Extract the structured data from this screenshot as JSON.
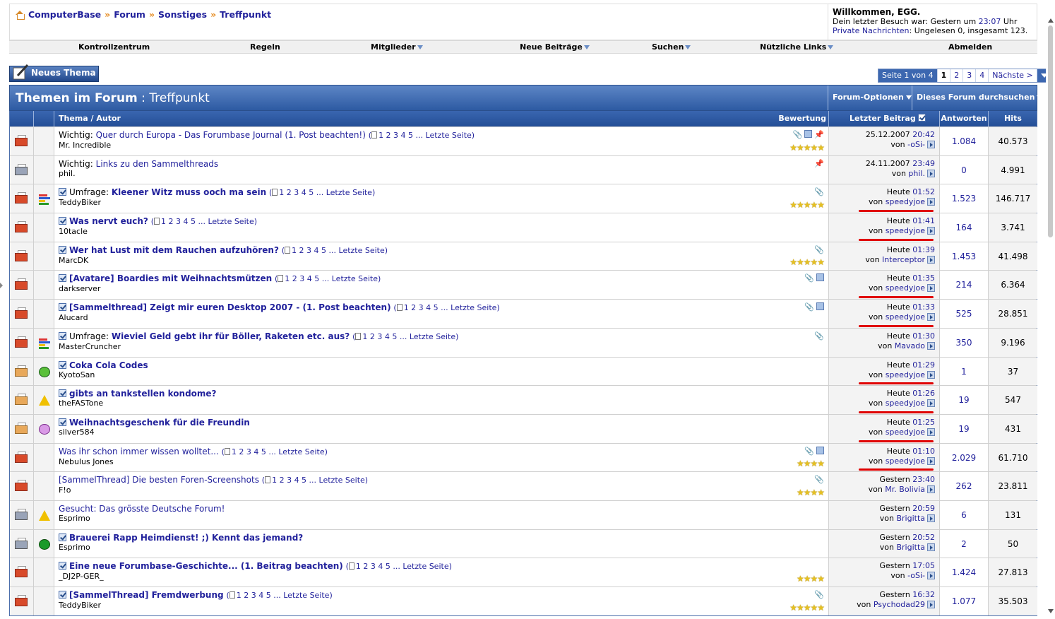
{
  "breadcrumb": [
    "ComputerBase",
    "Forum",
    "Sonstiges",
    "Treffpunkt"
  ],
  "breadcrumb_sep": "»",
  "welcome": {
    "title": "Willkommen, EGG.",
    "last_visit_prefix": "Dein letzter Besuch war: Gestern um",
    "last_visit_time": "23:07",
    "last_visit_suffix": "Uhr",
    "pm_label": "Private Nachrichten",
    "pm_status": ": Ungelesen 0, insgesamt 123."
  },
  "navbar": [
    "Kontrollzentrum",
    "Regeln",
    "Mitglieder",
    "Neue Beiträge",
    "Suchen",
    "Nützliche Links",
    "Abmelden"
  ],
  "new_thread_label": "Neues Thema",
  "pagination": {
    "info": "Seite 1 von 4",
    "pages": [
      "1",
      "2",
      "3",
      "4"
    ],
    "current": "1",
    "next": "Nächste >"
  },
  "forum": {
    "title_prefix": "Themen im Forum",
    "title_sep": " : ",
    "forum_name": "Treffpunkt",
    "options": "Forum-Optionen",
    "search": "Dieses Forum durchsuchen"
  },
  "columns": {
    "thread": "Thema / Autor",
    "rating": "Bewertung",
    "last_post": "Letzter Beitrag",
    "replies": "Antworten",
    "hits": "Hits"
  },
  "last_post_by": "von",
  "threads": [
    {
      "prefix": "Wichtig: ",
      "title": "Quer durch Europa - Das Forumbase Journal (1. Post beachten!)",
      "pages": "1 2 3 4 5 ... Letzte Seite",
      "author": "Mr. Incredible",
      "date": "25.12.2007",
      "time": "20:42",
      "user": "-oSi-",
      "replies": "1.084",
      "hits": "40.573",
      "bold": false,
      "check": false,
      "status": "new",
      "ticon": "",
      "stars": 5,
      "flags": [
        "clip",
        "chk",
        "pin"
      ],
      "red": false
    },
    {
      "prefix": "Wichtig: ",
      "title": "Links zu den Sammelthreads",
      "pages": "",
      "author": "phil.",
      "date": "24.11.2007",
      "time": "23:49",
      "user": "phil.",
      "replies": "0",
      "hits": "4.991",
      "bold": false,
      "check": false,
      "status": "lock",
      "ticon": "",
      "stars": 0,
      "flags": [
        "pin"
      ],
      "red": false
    },
    {
      "prefix": "Umfrage: ",
      "title": "Kleener Witz muss ooch ma sein",
      "pages": "1 2 3 4 5 ... Letzte Seite",
      "author": "TeddyBiker",
      "date": "Heute",
      "time": "01:52",
      "user": "speedyjoe",
      "replies": "1.523",
      "hits": "146.717",
      "bold": true,
      "check": true,
      "status": "new",
      "ticon": "poll",
      "stars": 5,
      "flags": [
        "clip"
      ],
      "red": true
    },
    {
      "prefix": "",
      "title": "Was nervt euch?",
      "pages": "1 2 3 4 5 ... Letzte Seite",
      "author": "10tacle",
      "date": "Heute",
      "time": "01:41",
      "user": "speedyjoe",
      "replies": "164",
      "hits": "3.741",
      "bold": true,
      "check": true,
      "status": "new",
      "ticon": "",
      "stars": 0,
      "flags": [],
      "red": true
    },
    {
      "prefix": "",
      "title": "Wer hat Lust mit dem Rauchen aufzuhören?",
      "pages": "1 2 3 4 5 ... Letzte Seite",
      "author": "MarcDK",
      "date": "Heute",
      "time": "01:39",
      "user": "Interceptor",
      "replies": "1.453",
      "hits": "41.498",
      "bold": true,
      "check": true,
      "status": "new",
      "ticon": "",
      "stars": 5,
      "flags": [
        "clip"
      ],
      "red": false
    },
    {
      "prefix": "",
      "title": "[Avatare] Boardies mit Weihnachtsmützen",
      "pages": "1 2 3 4 5 ... Letzte Seite",
      "author": "darkserver",
      "date": "Heute",
      "time": "01:35",
      "user": "speedyjoe",
      "replies": "214",
      "hits": "6.364",
      "bold": true,
      "check": true,
      "status": "new",
      "ticon": "",
      "stars": 0,
      "flags": [
        "clip",
        "chk"
      ],
      "red": true
    },
    {
      "prefix": "",
      "title": "[Sammelthread] Zeigt mir euren Desktop 2007 - (1. Post beachten)",
      "pages": "1 2 3 4 5 ... Letzte Seite",
      "author": "Alucard",
      "date": "Heute",
      "time": "01:33",
      "user": "speedyjoe",
      "replies": "525",
      "hits": "28.851",
      "bold": true,
      "check": true,
      "status": "new",
      "ticon": "",
      "stars": 0,
      "flags": [
        "clip",
        "chk"
      ],
      "red": true
    },
    {
      "prefix": "Umfrage: ",
      "title": "Wieviel Geld gebt ihr für Böller, Raketen etc. aus?",
      "pages": "1 2 3 4 5 ... Letzte Seite",
      "author": "MasterCruncher",
      "date": "Heute",
      "time": "01:30",
      "user": "Mavado",
      "replies": "350",
      "hits": "9.196",
      "bold": true,
      "check": true,
      "status": "new",
      "ticon": "poll",
      "stars": 0,
      "flags": [
        "clip"
      ],
      "red": false
    },
    {
      "prefix": "",
      "title": "Coka Cola Codes",
      "pages": "",
      "author": "KyotoSan",
      "date": "Heute",
      "time": "01:29",
      "user": "speedyjoe",
      "replies": "1",
      "hits": "37",
      "bold": true,
      "check": true,
      "status": "old",
      "ticon": "greensmile",
      "stars": 0,
      "flags": [],
      "red": true
    },
    {
      "prefix": "",
      "title": "gibts an tankstellen kondome?",
      "pages": "",
      "author": "theFASTone",
      "date": "Heute",
      "time": "01:26",
      "user": "speedyjoe",
      "replies": "19",
      "hits": "547",
      "bold": true,
      "check": true,
      "status": "old",
      "ticon": "warn",
      "stars": 0,
      "flags": [],
      "red": true
    },
    {
      "prefix": "",
      "title": "Weihnachtsgeschenk für die Freundin",
      "pages": "",
      "author": "silver584",
      "date": "Heute",
      "time": "01:25",
      "user": "speedyjoe",
      "replies": "19",
      "hits": "431",
      "bold": true,
      "check": true,
      "status": "old",
      "ticon": "purple",
      "stars": 0,
      "flags": [],
      "red": true
    },
    {
      "prefix": "",
      "title": "Was ihr schon immer wissen wolltet...",
      "pages": "1 2 3 4 5 ... Letzte Seite",
      "author": "Nebulus Jones",
      "date": "Heute",
      "time": "01:10",
      "user": "speedyjoe",
      "replies": "2.029",
      "hits": "61.710",
      "bold": false,
      "check": false,
      "status": "new",
      "ticon": "",
      "stars": 4,
      "flags": [
        "clip",
        "chk"
      ],
      "red": true
    },
    {
      "prefix": "",
      "title": "[SammelThread] Die besten Foren-Screenshots",
      "pages": "1 2 3 4 5 ... Letzte Seite",
      "author": "F!o",
      "date": "Gestern",
      "time": "23:40",
      "user": "Mr. Bolivia",
      "replies": "262",
      "hits": "23.811",
      "bold": false,
      "check": false,
      "status": "plain",
      "ticon": "",
      "stars": 4,
      "flags": [
        "clip"
      ],
      "red": false
    },
    {
      "prefix": "",
      "title": "Gesucht: Das grösste Deutsche Forum!",
      "pages": "",
      "author": "Esprimo",
      "date": "Gestern",
      "time": "20:59",
      "user": "Brigitta",
      "replies": "6",
      "hits": "131",
      "bold": false,
      "check": false,
      "status": "lock",
      "ticon": "warn",
      "stars": 0,
      "flags": [],
      "red": false
    },
    {
      "prefix": "",
      "title": "Brauerei Rapp Heimdienst! ;) Kennt das jemand?",
      "pages": "",
      "author": "Esprimo",
      "date": "Gestern",
      "time": "20:52",
      "user": "Brigitta",
      "replies": "2",
      "hits": "50",
      "bold": true,
      "check": true,
      "status": "lock",
      "ticon": "arrow",
      "stars": 0,
      "flags": [],
      "red": false
    },
    {
      "prefix": "",
      "title": "Eine neue Forumbase-Geschichte... (1. Beitrag beachten)",
      "pages": "1 2 3 4 5 ... Letzte Seite",
      "author": "_DJ2P-GER_",
      "date": "Gestern",
      "time": "17:05",
      "user": "-oSi-",
      "replies": "1.424",
      "hits": "27.813",
      "bold": true,
      "check": true,
      "status": "new",
      "ticon": "",
      "stars": 4,
      "flags": [],
      "red": false
    },
    {
      "prefix": "",
      "title": "[SammelThread] Fremdwerbung",
      "pages": "1 2 3 4 5 ... Letzte Seite",
      "author": "TeddyBiker",
      "date": "Gestern",
      "time": "16:32",
      "user": "Psychodad29",
      "replies": "1.077",
      "hits": "35.503",
      "bold": true,
      "check": true,
      "status": "new",
      "ticon": "",
      "stars": 5,
      "flags": [
        "clip"
      ],
      "red": false
    }
  ]
}
